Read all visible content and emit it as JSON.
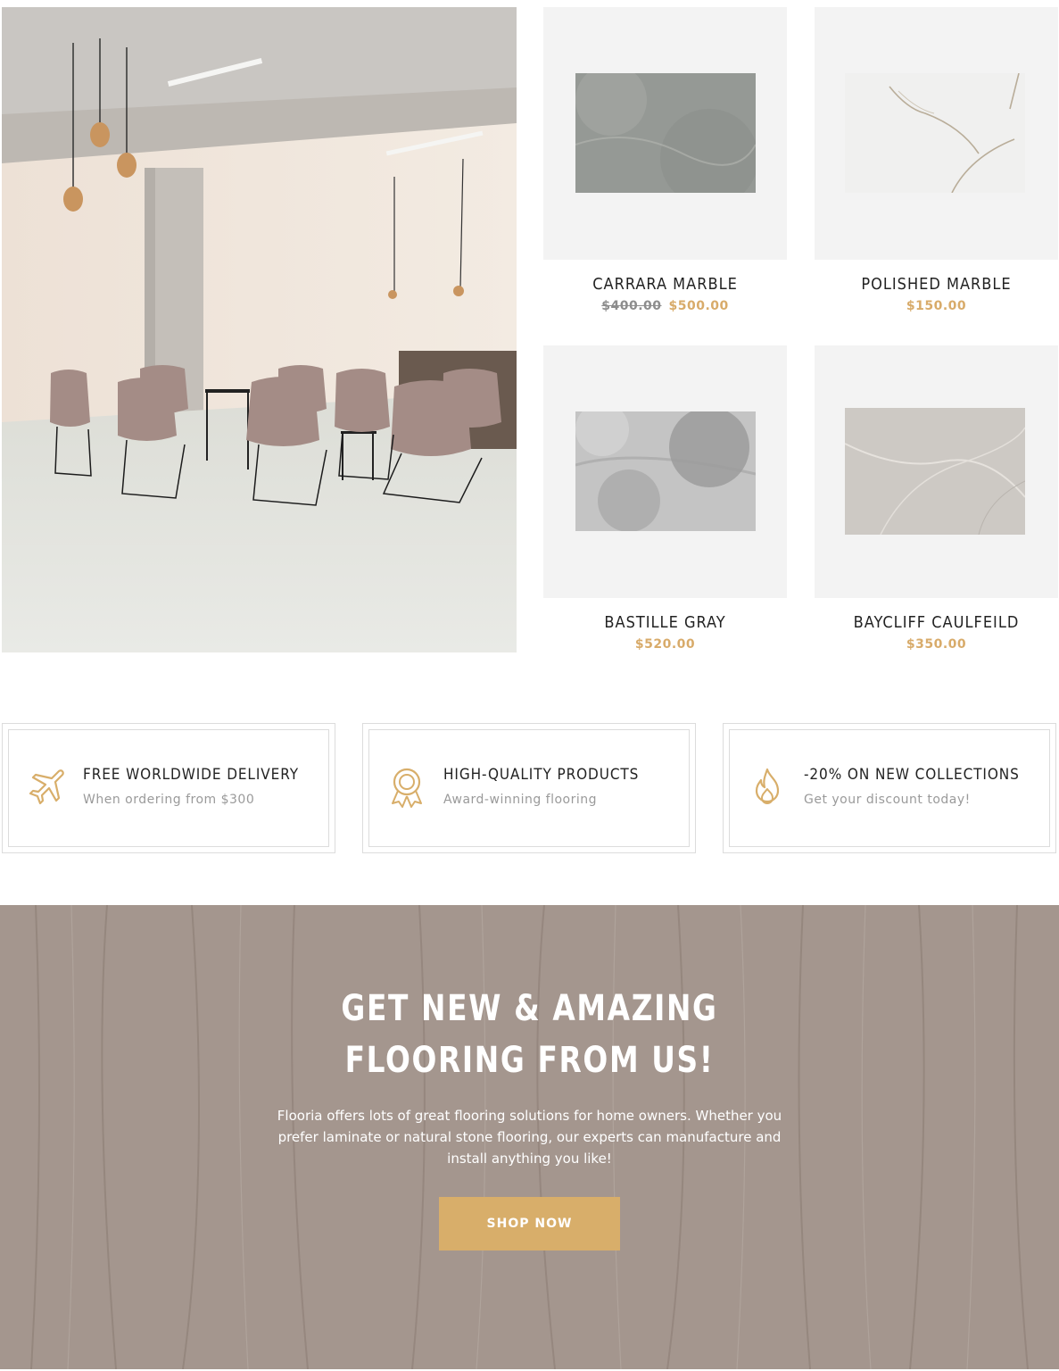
{
  "products": [
    {
      "name": "CARRARA MARBLE",
      "old_price": "$400.00",
      "price": "$500.00"
    },
    {
      "name": "POLISHED MARBLE",
      "old_price": "",
      "price": "$150.00"
    },
    {
      "name": "BASTILLE GRAY",
      "old_price": "",
      "price": "$520.00"
    },
    {
      "name": "BAYCLIFF CAULFEILD",
      "old_price": "",
      "price": "$350.00"
    }
  ],
  "features": [
    {
      "icon": "airplane-icon",
      "title": "FREE WORLDWIDE DELIVERY",
      "subtitle": "When ordering from $300"
    },
    {
      "icon": "award-icon",
      "title": "HIGH-QUALITY PRODUCTS",
      "subtitle": "Award-winning flooring"
    },
    {
      "icon": "flame-icon",
      "title": "-20% ON NEW COLLECTIONS",
      "subtitle": "Get your discount today!"
    }
  ],
  "banner": {
    "headline_line1": "GET NEW & AMAZING",
    "headline_line2": "FLOORING FROM US!",
    "body": "Flooria offers lots of great flooring solutions for home owners. Whether you prefer laminate or natural stone flooring, our experts can manufacture and install anything you like!",
    "button_label": "SHOP NOW"
  },
  "colors": {
    "accent": "#d8ae6a",
    "price": "#d8ab6a",
    "old_price": "#8d8d8d",
    "thumb_bg": "#f3f3f3",
    "border": "#dcdcdc"
  }
}
